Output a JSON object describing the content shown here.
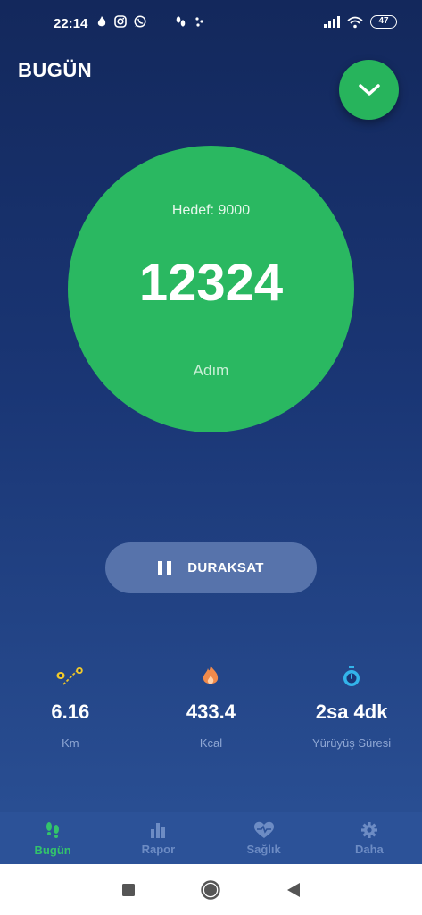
{
  "status_bar": {
    "time": "22:14",
    "battery": "47"
  },
  "header": {
    "title": "BUGÜN",
    "expand_icon": "chevron-down-icon"
  },
  "counter": {
    "goal_text": "Hedef: 9000",
    "steps": "12324",
    "unit": "Adım"
  },
  "pause_button": {
    "label": "DURAKSAT",
    "icon": "pause-icon"
  },
  "stats": [
    {
      "icon": "route-pin-icon",
      "value": "6.16",
      "label": "Km"
    },
    {
      "icon": "flame-icon",
      "value": "433.4",
      "label": "Kcal"
    },
    {
      "icon": "stopwatch-icon",
      "value": "2sa 4dk",
      "label": "Yürüyüş Süresi"
    }
  ],
  "tabs": [
    {
      "label": "Bugün",
      "icon": "footsteps-icon",
      "active": true
    },
    {
      "label": "Rapor",
      "icon": "bar-chart-icon",
      "active": false
    },
    {
      "label": "Sağlık",
      "icon": "heart-pulse-icon",
      "active": false
    },
    {
      "label": "Daha",
      "icon": "gear-icon",
      "active": false
    }
  ],
  "colors": {
    "accent_green": "#2ab861",
    "background_top": "#13285c",
    "background_bottom": "#2b5196",
    "tab_inactive": "#6d8cc4"
  }
}
